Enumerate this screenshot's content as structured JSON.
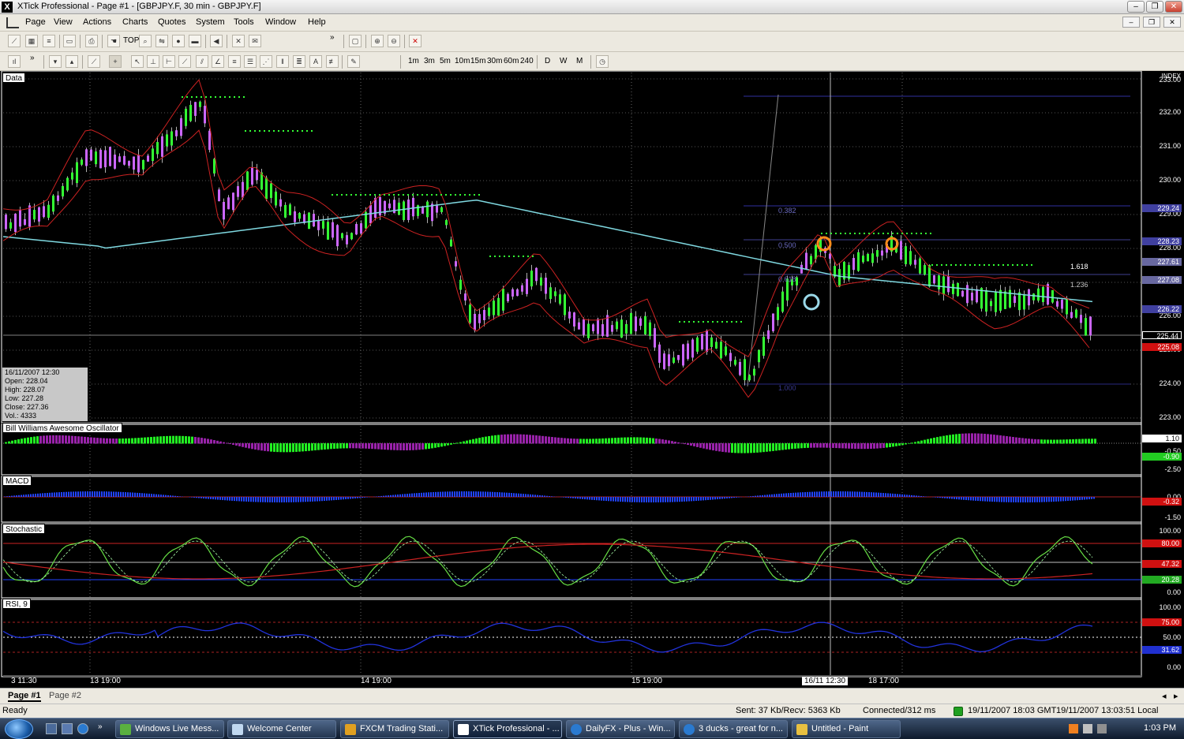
{
  "window": {
    "app_icon": "X",
    "title": "XTick Professional - Page #1 - [GBPJPY.F, 30 min - GBPJPY.F]",
    "minimize": "–",
    "restore": "❐",
    "close": "✕"
  },
  "menu": {
    "items": [
      "Page",
      "View",
      "Actions",
      "Charts",
      "Quotes",
      "System",
      "Tools",
      "Window",
      "Help"
    ],
    "mdi_minimize": "–",
    "mdi_restore": "❐",
    "mdi_close": "✕"
  },
  "toolbar2": {
    "timeframes": [
      "1m",
      "3m",
      "5m",
      "10m",
      "15m",
      "30m",
      "60m",
      "240"
    ],
    "periods": [
      "D",
      "W",
      "M"
    ],
    "more": "»"
  },
  "toolbar1": {
    "top_label": "TOP",
    "more": "»"
  },
  "panels": {
    "data": "Data",
    "awesome": "Bill Williams Awesome Oscillator",
    "macd": "MACD",
    "stochastic": "Stochastic",
    "rsi": "RSI, 9"
  },
  "ohlc_box": {
    "date": "16/11/2007 12:30",
    "open": "Open: 228.04",
    "high": "High: 228.07",
    "low": "Low: 227.28",
    "close": "Close: 227.36",
    "vol": "Vol.: 4333"
  },
  "price_axis": {
    "index_label": "INDEX",
    "ticks": [
      "233.00",
      "232.00",
      "231.00",
      "230.00",
      "229.00",
      "228.00",
      "227.00",
      "226.00",
      "225.00",
      "224.00",
      "223.00"
    ],
    "tags": {
      "t1": "229.24",
      "t2": "228.23",
      "t3": "227.61",
      "t4": "227.08",
      "t5": "226.22",
      "t6": "225.44",
      "t7": "225.08"
    }
  },
  "fib_labels": {
    "f1": "0.382",
    "f2": "0.500",
    "f3": "0.618",
    "f4": "1.618",
    "f5": "1.236",
    "f6": "1.000"
  },
  "ao_axis": {
    "v1": "1.10",
    "v2": "-0.50",
    "v3": "-0.90",
    "v4": "-2.50"
  },
  "macd_axis": {
    "v1": "0.00",
    "v2": "-0.32",
    "v3": "-1.50"
  },
  "stoch_axis": {
    "v1": "100.00",
    "v2": "80.00",
    "v3": "47.32",
    "v4": "20.28",
    "v5": "0.00"
  },
  "rsi_axis": {
    "v1": "100.00",
    "v2": "75.00",
    "v3": "50.00",
    "v4": "31.62",
    "v5": "0.00"
  },
  "time_axis": {
    "t0": "3 11:30",
    "t1": "13 19:00",
    "t2": "14 19:00",
    "t3": "15 19:00",
    "t4": "16/11 12:30",
    "t5": "18 17:00"
  },
  "page_tabs": [
    "Page #1",
    "Page #2"
  ],
  "status": {
    "ready": "Ready",
    "traffic": "Sent: 37 Kb/Recv: 5363 Kb",
    "connection": "Connected/312 ms",
    "gmt": "19/11/2007 18:03 GMT",
    "local": "19/11/2007 13:03:51 Local"
  },
  "taskbar": {
    "tasks": [
      "Windows Live Mess...",
      "Welcome Center",
      "FXCM Trading Stati...",
      "XTick Professional - ...",
      "DailyFX - Plus - Win...",
      "3 ducks - great for n...",
      "Untitled - Paint"
    ],
    "clock": "1:03 PM"
  },
  "colors": {
    "chart_bg": "#000000",
    "bull": "#33ff33",
    "bear": "#cc66ff",
    "ma_cyan": "#7fd8e0",
    "envelope": "#cc2222",
    "stoch_green": "#66dd44",
    "rsi_blue": "#2233dd",
    "macd_blue": "#2244ff",
    "ao_green": "#22ee22",
    "ao_purple": "#9922aa"
  }
}
